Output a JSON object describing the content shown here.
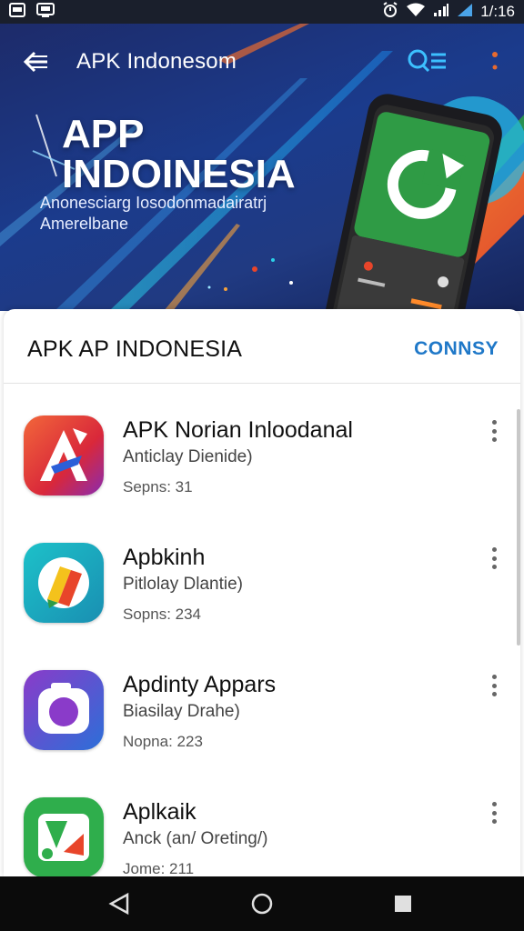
{
  "status_bar": {
    "time": "1/:16",
    "icons": [
      "image-icon",
      "download-icon",
      "alarm-icon",
      "wifi-icon",
      "signal-icon",
      "battery-icon"
    ]
  },
  "hero": {
    "app_title": "APK Indonesom",
    "title_line1": "APP",
    "title_line2": "INDOINESIA",
    "subtitle_line1": "Anonesciarg Iosodonmadairatrj",
    "subtitle_line2": "Amerelbane",
    "icons": [
      "back-arrow-icon",
      "search-list-icon",
      "more-vert-icon",
      "phone-illustration"
    ]
  },
  "section": {
    "title": "APK AP INDONESIA",
    "action": "CONNSY"
  },
  "apps": [
    {
      "name": "APK Norian Inloodanal",
      "desc": "Anticlay Dienide)",
      "meta": "Sepns: 31",
      "icon": "letter-a-app-icon"
    },
    {
      "name": "Apbkinh",
      "desc": "Pitlolay Dlantie)",
      "meta": "Sopns: 234",
      "icon": "pencil-app-icon"
    },
    {
      "name": "Apdinty Appars",
      "desc": "Biasilay Drahe)",
      "meta": "Nopna: 223",
      "icon": "camera-app-icon"
    },
    {
      "name": "Aplkaik",
      "desc": "Anck (an/ Oreting/)",
      "meta": "Jome: 211",
      "icon": "shapes-app-icon"
    }
  ],
  "colors": {
    "accent": "#1f78c8",
    "hero_bg": "#1b3b8c",
    "nav_bg": "#0b0b0b"
  }
}
